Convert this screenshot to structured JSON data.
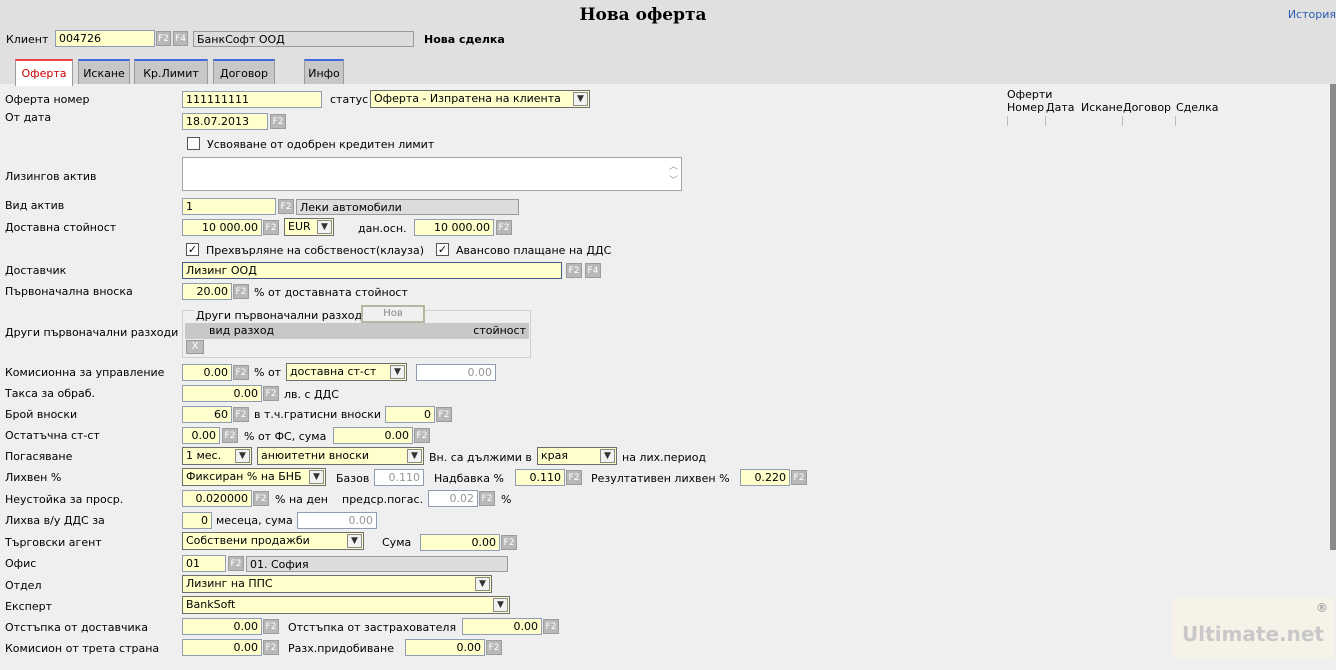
{
  "header": {
    "title": "Нова оферта",
    "history_link": "История",
    "client_label": "Клиент",
    "client_code": "004726",
    "client_name": "БанкСофт ООД",
    "deal_label": "Нова сделка"
  },
  "tabs": [
    {
      "label": "Оферта",
      "active": true
    },
    {
      "label": "Искане"
    },
    {
      "label": "Кр.Лимит"
    },
    {
      "label": "Договор"
    },
    {
      "label": "Инфо"
    }
  ],
  "buttons": {
    "f2": "F2",
    "f4": "F4",
    "new": "Нов",
    "delete": "X"
  },
  "form": {
    "offer_number_label": "Оферта номер",
    "offer_number": "111111111",
    "status_label": "статус",
    "status_value": "Оферта - Изпратена на клиента",
    "from_date_label": "От дата",
    "from_date": "18.07.2013",
    "credit_limit_label": "Усвояване от одобрен кредитен лимит",
    "credit_limit_checked": false,
    "leasing_asset_label": "Лизингов актив",
    "asset_type_label": "Вид актив",
    "asset_type_code": "1",
    "asset_type_name": "Леки автомобили",
    "delivery_value_label": "Доставна стойност",
    "delivery_value": "10 000.00",
    "currency": "EUR",
    "tax_base_label": "дан.осн.",
    "tax_base": "10 000.00",
    "ownership_transfer_label": "Прехвърляне на собственост(клауза)",
    "ownership_transfer_checked": true,
    "advance_vat_label": "Авансово плащане на ДДС",
    "advance_vat_checked": true,
    "supplier_label": "Доставчик",
    "supplier": "Лизинг ООД",
    "initial_payment_label": "Първоначална вноска",
    "initial_payment": "20.00",
    "initial_payment_suffix": "% от доставната стойност",
    "other_costs_label": "Други първоначални разходи",
    "other_costs_group": "Други първоначални разходи",
    "other_costs_col_type": "вид разход",
    "other_costs_col_value": "стойност",
    "mgmt_fee_label": "Комисионна за управление",
    "mgmt_fee": "0.00",
    "mgmt_fee_pct_of": "% от",
    "mgmt_fee_basis": "доставна ст-ст",
    "mgmt_fee_amount": "0.00",
    "processing_fee_label": "Такса за обраб.",
    "processing_fee": "0.00",
    "processing_fee_suffix": "лв. с ДДС",
    "installments_label": "Брой вноски",
    "installments": "60",
    "free_installments_label": "в т.ч.гратисни вноски",
    "free_installments": "0",
    "residual_label": "Остатъчна ст-ст",
    "residual_pct": "0.00",
    "residual_mid": "% от ФС, сума",
    "residual_amount": "0.00",
    "repayment_label": "Погасяване",
    "repayment_period": "1 мес.",
    "repayment_type": "анюитетни вноски",
    "due_label": "Вн. са дължими в",
    "due_value": "края",
    "due_suffix": "на лих.период",
    "interest_label": "Лихвен %",
    "interest_type": "Фиксиран % на БНБ",
    "base_label": "Базов",
    "base_value": "0.110",
    "margin_label": "Надбавка %",
    "margin_value": "0.110",
    "result_label": "Резултативен лихвен %",
    "result_value": "0.220",
    "penalty_label": "Неустойка за проср.",
    "penalty_value": "0.020000",
    "penalty_suffix": "% на ден",
    "early_label": "предср.погас.",
    "early_value": "0.02",
    "early_suffix": "%",
    "vat_interest_label": "Лихва в/у ДДС за",
    "vat_interest_months": "0",
    "vat_interest_mid": "месеца, сума",
    "vat_interest_amount": "0.00",
    "agent_label": "Търговски агент",
    "agent_value": "Собствени продажби",
    "agent_sum_label": "Сума",
    "agent_sum": "0.00",
    "office_label": "Офис",
    "office_code": "01",
    "office_name": "01. София",
    "dept_label": "Отдел",
    "dept_value": "Лизинг на ППС",
    "expert_label": "Експерт",
    "expert_value": "BankSoft",
    "supplier_discount_label": "Отстъпка от доставчика",
    "supplier_discount": "0.00",
    "insurer_discount_label": "Отстъпка от застрахователя",
    "insurer_discount": "0.00",
    "third_party_label": "Комисион от трета страна",
    "third_party": "0.00",
    "acquisition_label": "Разх.придобиване",
    "acquisition": "0.00"
  },
  "offers_panel": {
    "title": "Оферти",
    "columns": [
      "Номер",
      "Дата",
      "Искане",
      "Договор",
      "Сделка"
    ]
  },
  "watermark": {
    "text": "Ultimate.net",
    "mark": "®"
  }
}
